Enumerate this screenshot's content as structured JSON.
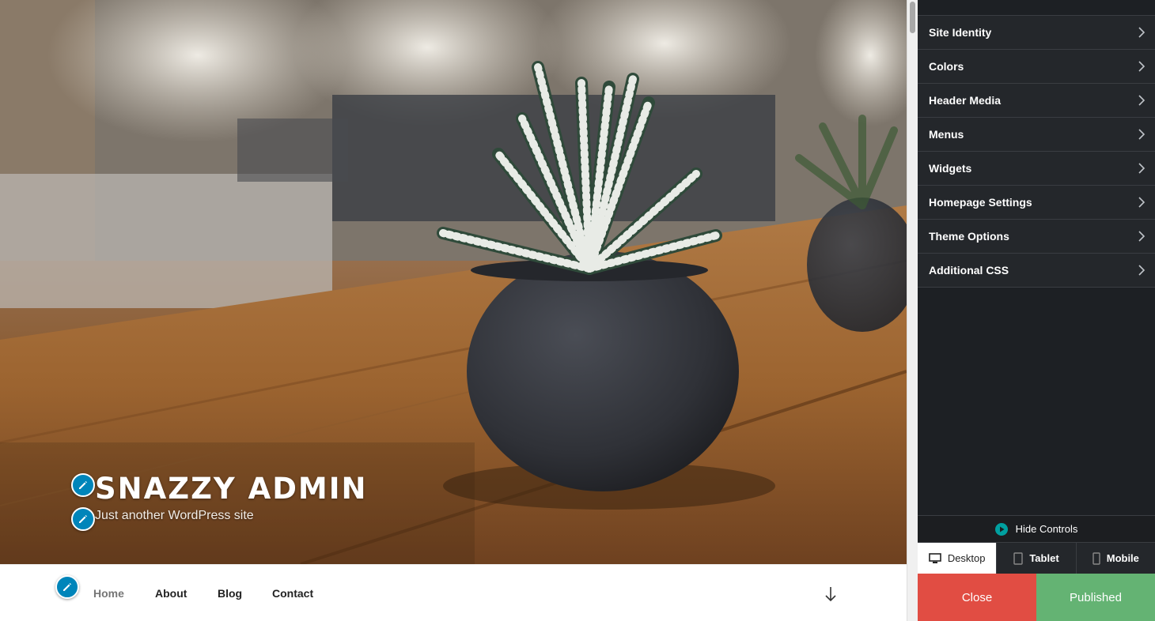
{
  "site": {
    "title": "SNAZZY ADMIN",
    "tagline": "Just another WordPress site"
  },
  "nav": {
    "items": [
      {
        "label": "Home",
        "current": true
      },
      {
        "label": "About",
        "current": false
      },
      {
        "label": "Blog",
        "current": false
      },
      {
        "label": "Contact",
        "current": false
      }
    ]
  },
  "customizer": {
    "sections": [
      {
        "label": "Site Identity"
      },
      {
        "label": "Colors"
      },
      {
        "label": "Header Media"
      },
      {
        "label": "Menus"
      },
      {
        "label": "Widgets"
      },
      {
        "label": "Homepage Settings"
      },
      {
        "label": "Theme Options"
      },
      {
        "label": "Additional CSS"
      }
    ],
    "hide_controls_label": "Hide Controls",
    "devices": [
      {
        "label": "Desktop",
        "icon": "desktop-icon",
        "active": true
      },
      {
        "label": "Tablet",
        "icon": "tablet-icon",
        "active": false
      },
      {
        "label": "Mobile",
        "icon": "mobile-icon",
        "active": false
      }
    ],
    "close_label": "Close",
    "publish_label": "Published"
  },
  "colors": {
    "accent_blue": "#0085ba",
    "close_red": "#e14d43",
    "publish_green": "#64b373",
    "panel_dark": "#1d2024",
    "hide_controls_teal": "#00a0a0"
  }
}
